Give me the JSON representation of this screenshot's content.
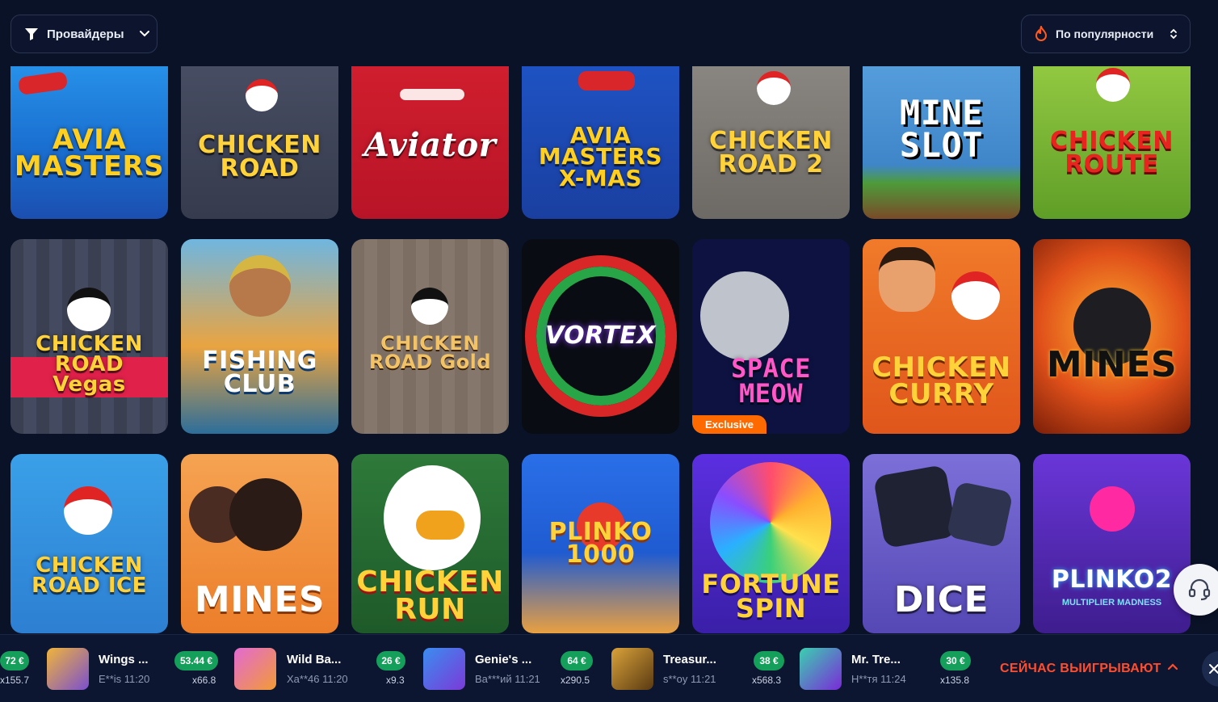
{
  "filters": {
    "providers_label": "Провайдеры",
    "sort_label": "По популярности"
  },
  "games": [
    {
      "title": "AVIA MASTERS",
      "icon": "plane-icon"
    },
    {
      "title": "CHICKEN ROAD",
      "icon": "chicken-icon"
    },
    {
      "title": "Aviator",
      "icon": "plane-icon"
    },
    {
      "title": "AVIA MASTERS X-MAS",
      "icon": "plane-icon"
    },
    {
      "title": "CHICKEN ROAD 2",
      "icon": "chicken-icon"
    },
    {
      "title": "MINE SLOT",
      "icon": "pickaxe-icon"
    },
    {
      "title": "CHICKEN ROUTE",
      "icon": "chicken-icon"
    },
    {
      "title": "CHICKEN ROAD Vegas",
      "icon": "chicken-icon"
    },
    {
      "title": "FISHING CLUB",
      "icon": "fish-icon"
    },
    {
      "title": "CHICKEN ROAD Gold",
      "icon": "chicken-icon"
    },
    {
      "title": "VORTEX",
      "icon": "wheel-icon"
    },
    {
      "title": "SPACE MEOW",
      "icon": "rocket-icon",
      "badge": "Exclusive"
    },
    {
      "title": "CHICKEN CURRY",
      "icon": "chicken-icon"
    },
    {
      "title": "MINES",
      "icon": "bomb-icon"
    },
    {
      "title": "CHICKEN ROAD ICE",
      "icon": "chicken-icon"
    },
    {
      "title": "MINES",
      "icon": "bomb-icon"
    },
    {
      "title": "CHICKEN RUN",
      "icon": "chicken-icon"
    },
    {
      "title": "PLINKO 1000",
      "icon": "ball-icon"
    },
    {
      "title": "FORTUNE SPIN",
      "icon": "wheel-icon"
    },
    {
      "title": "DICE",
      "icon": "dice-icon"
    },
    {
      "title": "PLINKO2",
      "subtitle": "MULTIPLIER MADNESS",
      "icon": "ball-icon"
    }
  ],
  "winners": {
    "label": "СЕЙЧАС ВЫИГРЫВАЮТ",
    "items": [
      {
        "amount": "72 €",
        "multiplier": "x155.7"
      },
      {
        "game": "Wings ...",
        "user": "E**is 11:20",
        "amount": "53.44 €",
        "multiplier": "x66.8"
      },
      {
        "game": "Wild Ba...",
        "user": "Xa**46 11:20",
        "amount": "26 €",
        "multiplier": "x9.3"
      },
      {
        "game": "Genie's ...",
        "user": "Ва***ий 11:21",
        "amount": "64 €",
        "multiplier": "x290.5"
      },
      {
        "game": "Treasur...",
        "user": "s**oy 11:21",
        "amount": "38 €",
        "multiplier": "x568.3"
      },
      {
        "game": "Mr. Tre...",
        "user": "Н**тя 11:24",
        "amount": "30 €",
        "multiplier": "x135.8"
      }
    ]
  },
  "colors": {
    "background": "#0a1228",
    "live_accent": "#ff4d2e",
    "win_badge": "#14a05a",
    "exclusive_badge": "#ff6a00"
  }
}
